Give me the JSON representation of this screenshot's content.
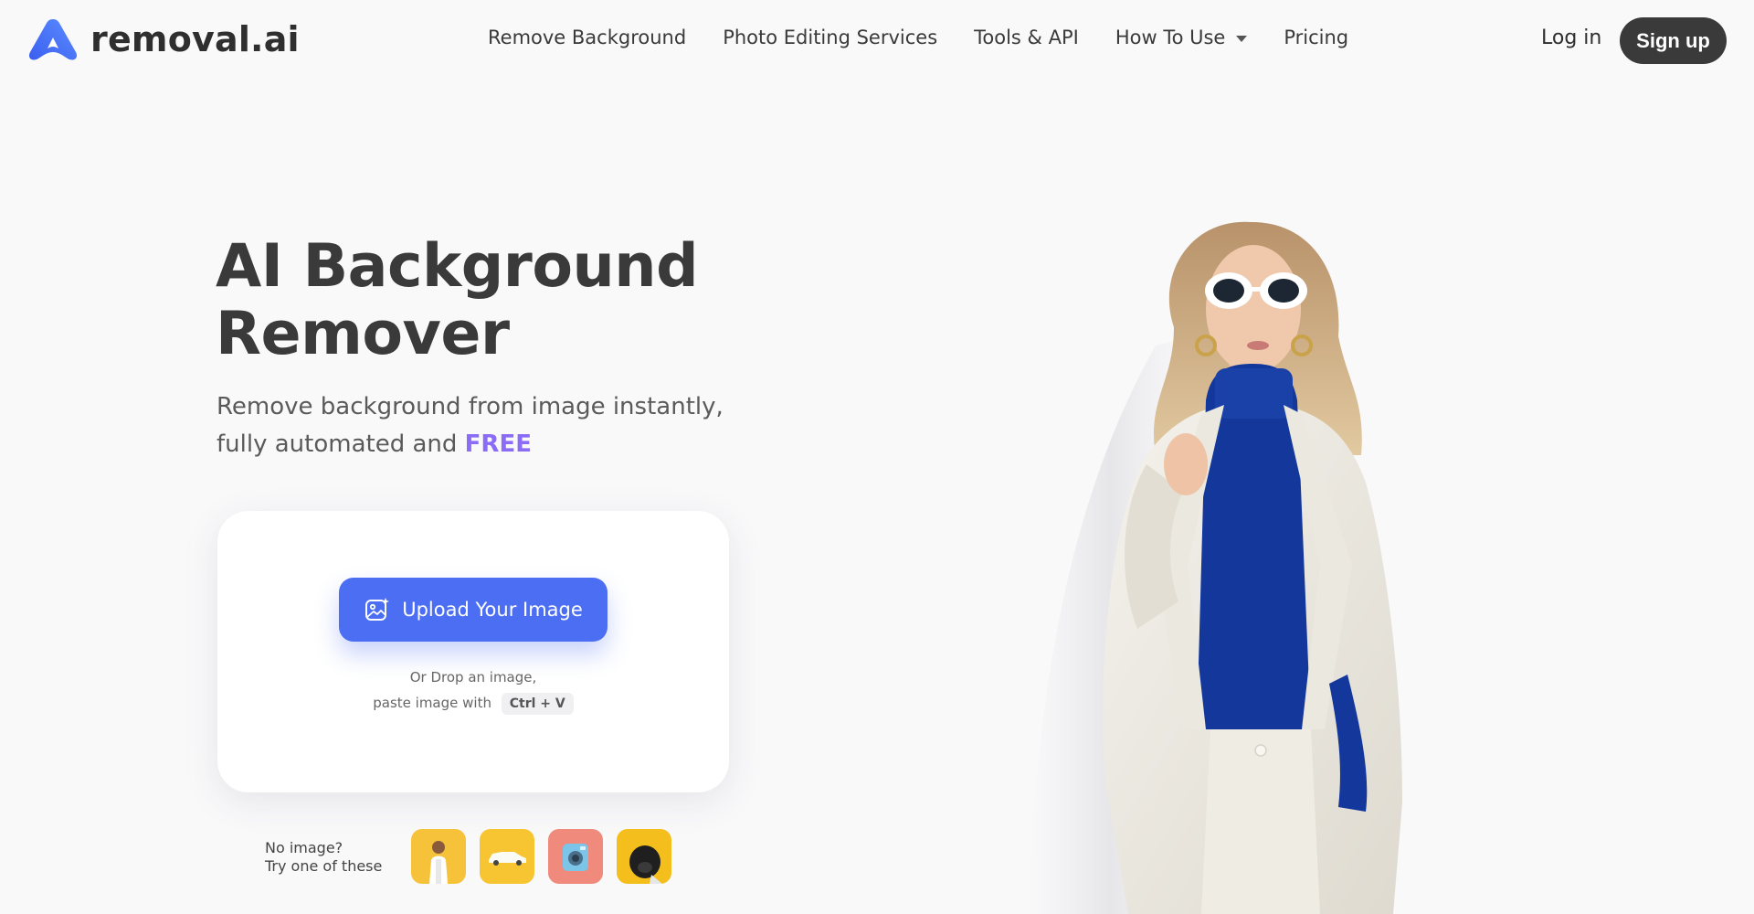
{
  "header": {
    "logo_text": "removal.ai",
    "nav": [
      {
        "label": "Remove Background"
      },
      {
        "label": "Photo Editing Services"
      },
      {
        "label": "Tools & API"
      },
      {
        "label": "How To Use",
        "has_dropdown": true
      },
      {
        "label": "Pricing"
      }
    ],
    "login_label": "Log in",
    "signup_label": "Sign up"
  },
  "hero": {
    "title_line1": "AI Background",
    "title_line2": "Remover",
    "subtitle_line1": "Remove background from image instantly,",
    "subtitle_line2": "fully automated and",
    "subtitle_highlight": "FREE"
  },
  "upload": {
    "button_label": "Upload Your Image",
    "drop_text": "Or Drop an image,",
    "paste_text": "paste image with",
    "shortcut": "Ctrl + V"
  },
  "samples": {
    "label_line1": "No image?",
    "label_line2": "Try one of these",
    "items": [
      {
        "icon": "woman-sample-icon"
      },
      {
        "icon": "car-sample-icon"
      },
      {
        "icon": "camera-sample-icon"
      },
      {
        "icon": "dog-sample-icon"
      }
    ]
  },
  "colors": {
    "accent": "#4b6ef2",
    "free": "#8b6cf6",
    "dark_button": "#3a3a3a",
    "background": "#f9f9fa"
  }
}
